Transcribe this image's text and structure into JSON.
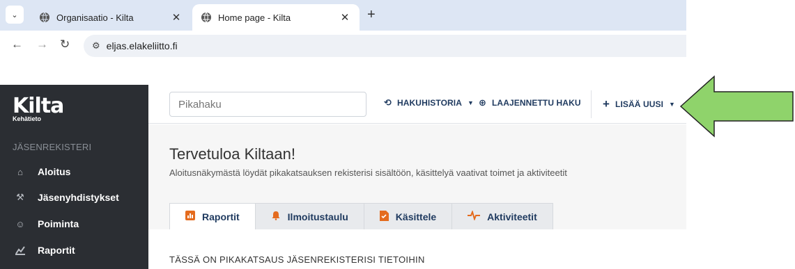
{
  "browser": {
    "tabs": [
      {
        "title": "Organisaatio - Kilta",
        "active": false
      },
      {
        "title": "Home page - Kilta",
        "active": true
      }
    ],
    "url": "eljas.elakeliitto.fi"
  },
  "app": {
    "brand": "Kilta",
    "brand_sub": "Kehätieto",
    "sidebar": {
      "section": "JÄSENREKISTERI",
      "items": [
        {
          "label": "Aloitus",
          "icon": "home-icon"
        },
        {
          "label": "Jäsenyhdistykset",
          "icon": "gavel-icon"
        },
        {
          "label": "Poiminta",
          "icon": "people-icon"
        },
        {
          "label": "Raportit",
          "icon": "chart-icon"
        }
      ]
    },
    "topbar": {
      "search_placeholder": "Pikahaku",
      "history": "HAKUHISTORIA",
      "advanced": "LAAJENNETTU HAKU",
      "add_new": "LISÄÄ UUSI"
    },
    "main": {
      "title": "Tervetuloa Kiltaan!",
      "subtitle": "Aloitusnäkymästä löydät pikakatsauksen rekisterisi sisältöön, käsittelyä vaativat toimet ja aktiviteetit",
      "tabs": [
        {
          "label": "Raportit",
          "icon": "chart-icon",
          "color": "#e46b1e"
        },
        {
          "label": "Ilmoitustaulu",
          "icon": "bell-icon",
          "color": "#e46b1e"
        },
        {
          "label": "Käsittele",
          "icon": "document-icon",
          "color": "#e46b1e"
        },
        {
          "label": "Aktiviteetit",
          "icon": "pulse-icon",
          "color": "#e46b1e"
        }
      ],
      "panel_title": "TÄSSÄ ON PIKAKATSAUS JÄSENREKISTERISI TIETOIHIN"
    }
  },
  "colors": {
    "sidebar_bg": "#2b2e33",
    "accent_orange": "#e46b1e",
    "arrow_fill": "#8fd36b"
  }
}
